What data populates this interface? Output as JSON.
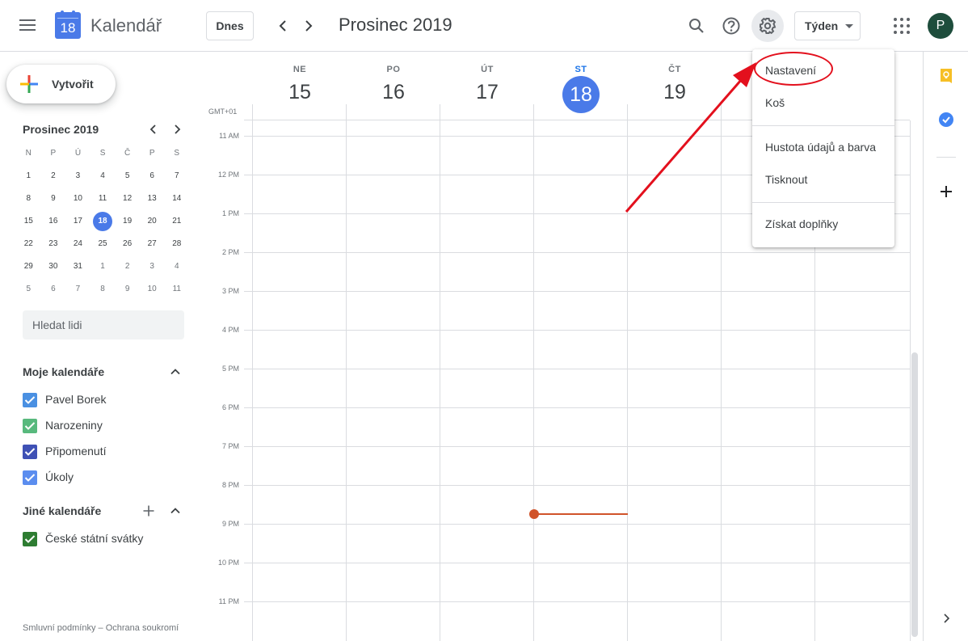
{
  "header": {
    "app_name": "Kalendář",
    "logo_day": "18",
    "today_label": "Dnes",
    "title": "Prosinec 2019",
    "view_label": "Týden",
    "avatar_letter": "P"
  },
  "sidebar": {
    "create_label": "Vytvořit",
    "mini_calendar": {
      "title": "Prosinec 2019",
      "weekdays": [
        "N",
        "P",
        "Ú",
        "S",
        "Č",
        "P",
        "S"
      ],
      "weeks": [
        [
          "1",
          "2",
          "3",
          "4",
          "5",
          "6",
          "7"
        ],
        [
          "8",
          "9",
          "10",
          "11",
          "12",
          "13",
          "14"
        ],
        [
          "15",
          "16",
          "17",
          "18",
          "19",
          "20",
          "21"
        ],
        [
          "22",
          "23",
          "24",
          "25",
          "26",
          "27",
          "28"
        ],
        [
          "29",
          "30",
          "31",
          "1",
          "2",
          "3",
          "4"
        ],
        [
          "5",
          "6",
          "7",
          "8",
          "9",
          "10",
          "11"
        ]
      ],
      "today": "18"
    },
    "search_people_placeholder": "Hledat lidi",
    "my_calendars_title": "Moje kalendáře",
    "my_calendars": [
      {
        "name": "Pavel Borek",
        "color": "#4a90e2"
      },
      {
        "name": "Narozeniny",
        "color": "#58b97d"
      },
      {
        "name": "Připomenutí",
        "color": "#3f51b5"
      },
      {
        "name": "Úkoly",
        "color": "#5b8def"
      }
    ],
    "other_calendars_title": "Jiné kalendáře",
    "other_calendars": [
      {
        "name": "České státní svátky",
        "color": "#2e7d32"
      }
    ],
    "footer": "Smluvní podmínky – Ochrana soukromí"
  },
  "week": {
    "timezone": "GMT+01",
    "days": [
      {
        "name": "NE",
        "date": "15"
      },
      {
        "name": "PO",
        "date": "16"
      },
      {
        "name": "ÚT",
        "date": "17"
      },
      {
        "name": "ST",
        "date": "18",
        "today": true
      },
      {
        "name": "ČT",
        "date": "19"
      }
    ],
    "hours": [
      "11 AM",
      "12 PM",
      "1 PM",
      "2 PM",
      "3 PM",
      "4 PM",
      "5 PM",
      "6 PM",
      "7 PM",
      "8 PM",
      "9 PM",
      "10 PM",
      "11 PM"
    ]
  },
  "settings_menu": {
    "items": [
      "Nastavení",
      "Koš",
      "Hustota údajů a barva",
      "Tisknout",
      "Získat doplňky"
    ]
  },
  "colors": {
    "accent": "#1a73e8",
    "today_circle": "#4a7ae8",
    "now_indicator": "#d0532a",
    "annotation": "#e3101d"
  }
}
